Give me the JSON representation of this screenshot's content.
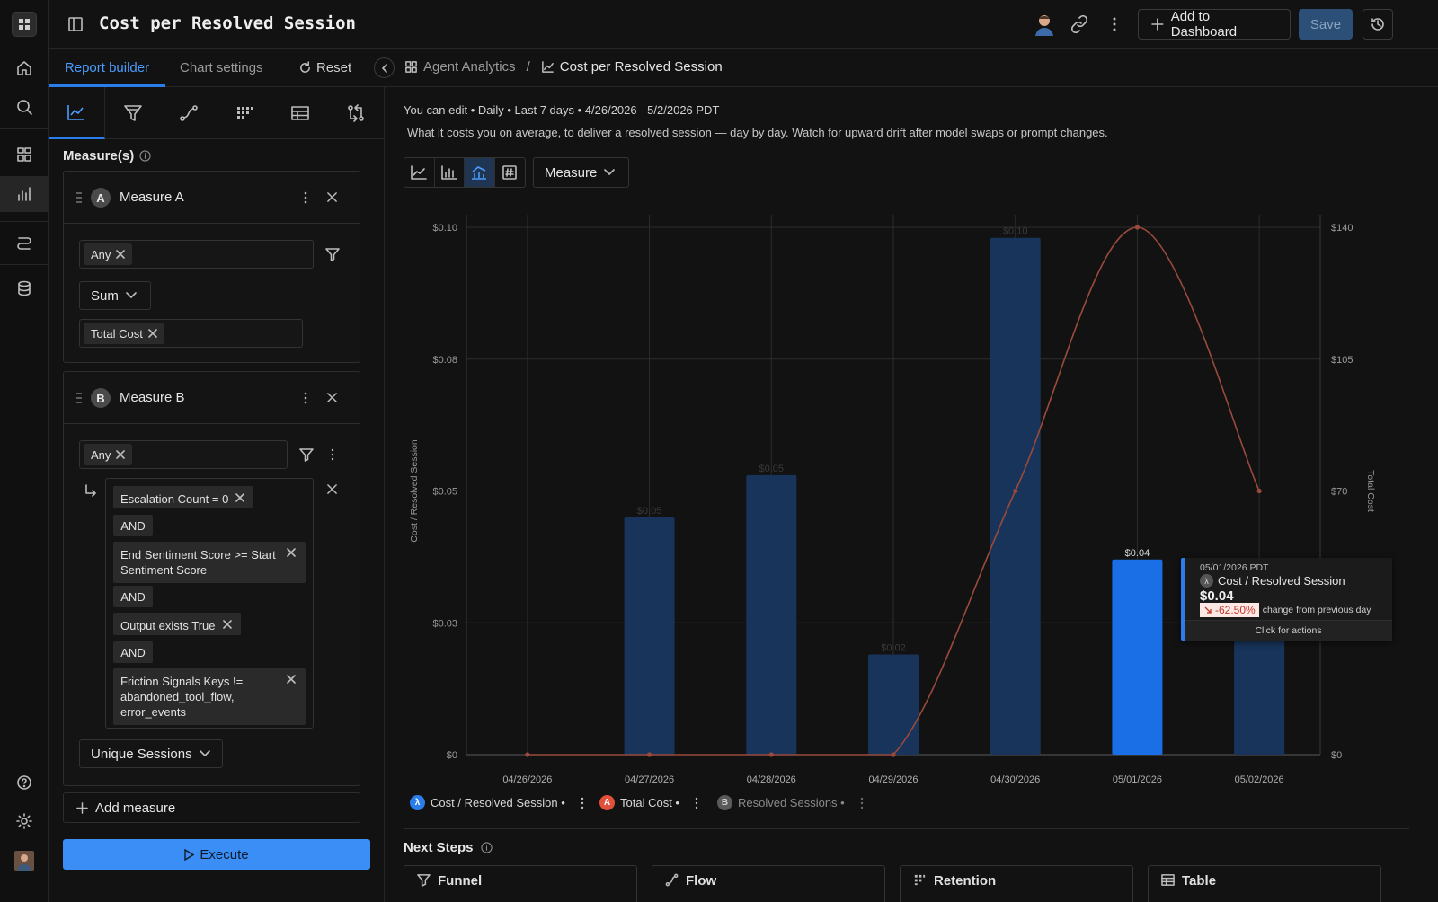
{
  "window": {
    "title": "Cost per Resolved Session"
  },
  "header": {
    "add_dashboard_label": "Add to Dashboard",
    "save_label": "Save"
  },
  "tabs": [
    {
      "label": "Report builder"
    },
    {
      "label": "Chart settings"
    },
    {
      "label": "Reset"
    }
  ],
  "breadcrumb": {
    "parent": "Agent Analytics",
    "sep": "/",
    "current": "Cost per Resolved Session"
  },
  "panel": {
    "section_label": "Measure(s)",
    "measure_a": {
      "badge": "A",
      "name": "Measure A",
      "filter_chip": "Any",
      "agg": "Sum",
      "property_chip": "Total Cost"
    },
    "measure_b": {
      "badge": "B",
      "name": "Measure B",
      "filter_chip": "Any",
      "conditions": [
        "Escalation Count = 0",
        "End Sentiment Score >= Start Sentiment Score",
        "Output exists True",
        "Friction Signals Keys != abandoned_tool_flow, error_events"
      ],
      "and_label": "AND",
      "agg": "Unique Sessions"
    },
    "add_measure": "Add measure",
    "execute": "Execute"
  },
  "report": {
    "meta": "You can edit • Daily • Last 7 days • 4/26/2026 - 5/2/2026 PDT",
    "description": "What it costs you on average, to deliver a resolved session — day by day. Watch for upward drift after model swaps or prompt changes.",
    "measure_dropdown": "Measure"
  },
  "chart_data": {
    "type": "bar",
    "categories": [
      "04/26/2026",
      "04/27/2026",
      "04/28/2026",
      "04/29/2026",
      "04/30/2026",
      "05/01/2026",
      "05/02/2026"
    ],
    "series": [
      {
        "name": "Cost / Resolved Session",
        "type": "bar",
        "axis": "left",
        "values": [
          0,
          0.045,
          0.053,
          0.019,
          0.098,
          0.037,
          0.0235
        ],
        "data_labels": [
          "",
          "$0.05",
          "$0.05",
          "$0.02",
          "$0.10",
          "$0.04",
          ""
        ],
        "color": "#18345a",
        "highlight_color": "#1a6fe6",
        "highlight_index": 5
      },
      {
        "name": "Total Cost",
        "type": "line",
        "axis": "right",
        "values": [
          0,
          0,
          0,
          0,
          70,
          140,
          70
        ],
        "color": "#9a4a3c"
      }
    ],
    "y_left": {
      "label": "Cost / Resolved Session",
      "ticks": [
        "$0",
        "$0.03",
        "$0.05",
        "$0.08",
        "$0.10"
      ],
      "ylim": [
        0,
        0.1
      ]
    },
    "y_right": {
      "label": "Total Cost",
      "ticks": [
        "$0",
        "$70",
        "$105",
        "$140"
      ],
      "ylim": [
        0,
        140
      ]
    },
    "grid": true
  },
  "tooltip": {
    "date": "05/01/2026 PDT",
    "series": "Cost / Resolved Session",
    "value": "$0.04",
    "change": "-62.50%",
    "change_text": "change from previous day",
    "action": "Click for actions"
  },
  "legend": [
    {
      "badge": "λ",
      "label": "Cost / Resolved Session •",
      "color": "#2b7de9"
    },
    {
      "badge": "A",
      "label": "Total Cost •",
      "color": "#e0503a"
    },
    {
      "badge": "B",
      "label": "Resolved Sessions •",
      "color": "#5a5a5a"
    }
  ],
  "next_steps": {
    "title": "Next Steps",
    "cards": [
      {
        "label": "Funnel"
      },
      {
        "label": "Flow"
      },
      {
        "label": "Retention"
      },
      {
        "label": "Table"
      }
    ]
  }
}
